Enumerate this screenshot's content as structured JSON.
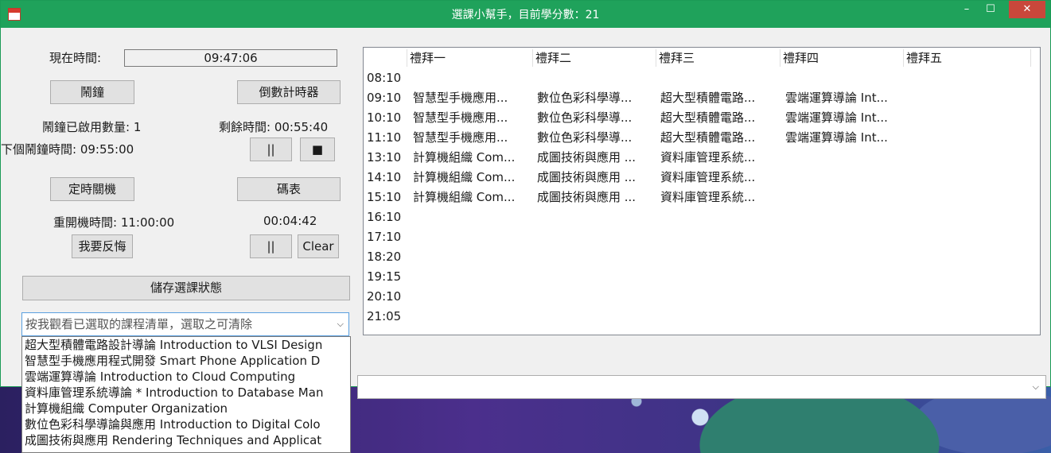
{
  "window": {
    "title": "選課小幫手，目前學分數：21"
  },
  "left": {
    "now_label": "現在時間:",
    "now_value": "09:47:06",
    "alarm_button": "鬧鐘",
    "countdown_button": "倒數計時器",
    "alarm_count": "鬧鐘已啟用數量: 1",
    "remaining": "剩餘時間: 00:55:40",
    "next_alarm": "下個鬧鐘時間:  09:55:00",
    "pause_symbol": "||",
    "stop_symbol": "■",
    "shutdown_button": "定時關機",
    "stopwatch_button": "碼表",
    "restart_time": "重開機時間: 11:00:00",
    "stopwatch_value": "00:04:42",
    "regret_button": "我要反悔",
    "sw_pause_symbol": "||",
    "clear_button": "Clear",
    "save_button": "儲存選課狀態",
    "combo_placeholder": "按我觀看已選取的課程清單，選取之可清除",
    "dropdown_items": [
      "超大型積體電路設計導論  Introduction to VLSI Design",
      "智慧型手機應用程式開發  Smart Phone Application D",
      "雲端運算導論  Introduction to Cloud Computing",
      "資料庫管理系統導論 * Introduction to Database Man",
      "計算機組織  Computer Organization",
      "數位色彩科學導論與應用  Introduction to Digital Colo",
      "成圖技術與應用  Rendering Techniques and Applicat"
    ]
  },
  "schedule": {
    "days": [
      "禮拜一",
      "禮拜二",
      "禮拜三",
      "禮拜四",
      "禮拜五"
    ],
    "rows": [
      {
        "time": "08:10",
        "cells": [
          "",
          "",
          "",
          "",
          ""
        ]
      },
      {
        "time": "09:10",
        "cells": [
          "智慧型手機應用...",
          "數位色彩科學導...",
          "超大型積體電路...",
          "雲端運算導論  Int...",
          ""
        ]
      },
      {
        "time": "10:10",
        "cells": [
          "智慧型手機應用...",
          "數位色彩科學導...",
          "超大型積體電路...",
          "雲端運算導論  Int...",
          ""
        ]
      },
      {
        "time": "11:10",
        "cells": [
          "智慧型手機應用...",
          "數位色彩科學導...",
          "超大型積體電路...",
          "雲端運算導論  Int...",
          ""
        ]
      },
      {
        "time": "13:10",
        "cells": [
          "計算機組織  Com...",
          "成圖技術與應用  ...",
          "資料庫管理系統...",
          "",
          ""
        ]
      },
      {
        "time": "14:10",
        "cells": [
          "計算機組織  Com...",
          "成圖技術與應用  ...",
          "資料庫管理系統...",
          "",
          ""
        ]
      },
      {
        "time": "15:10",
        "cells": [
          "計算機組織  Com...",
          "成圖技術與應用  ...",
          "資料庫管理系統...",
          "",
          ""
        ]
      },
      {
        "time": "16:10",
        "cells": [
          "",
          "",
          "",
          "",
          ""
        ]
      },
      {
        "time": "17:10",
        "cells": [
          "",
          "",
          "",
          "",
          ""
        ]
      },
      {
        "time": "18:20",
        "cells": [
          "",
          "",
          "",
          "",
          ""
        ]
      },
      {
        "time": "19:15",
        "cells": [
          "",
          "",
          "",
          "",
          ""
        ]
      },
      {
        "time": "20:10",
        "cells": [
          "",
          "",
          "",
          "",
          ""
        ]
      },
      {
        "time": "21:05",
        "cells": [
          "",
          "",
          "",
          "",
          ""
        ]
      }
    ]
  },
  "colors": {
    "titlebar": "#1fa25b",
    "close": "#c9473b",
    "combo_border": "#5aa0e0"
  }
}
